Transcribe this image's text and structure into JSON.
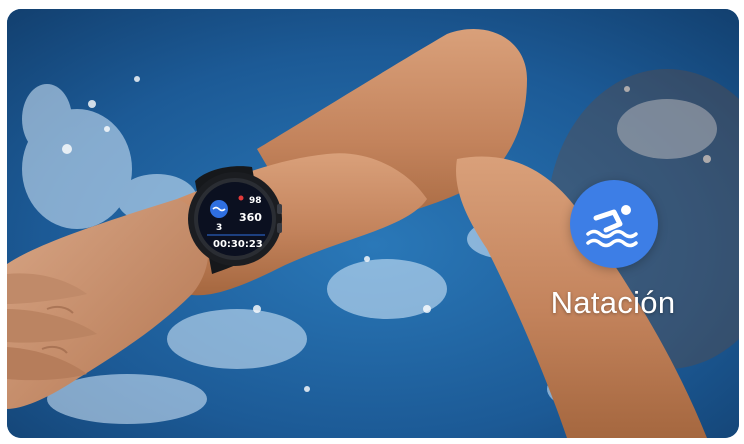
{
  "activity": {
    "label": "Natación",
    "icon": "swimming-icon",
    "badge_color": "#3d7ee6"
  },
  "watch_screen": {
    "heart_rate": "98",
    "distance": "360",
    "laps": "3",
    "duration": "00:30:23"
  },
  "colors": {
    "water": "#1f5d96",
    "skin": "#c98a63",
    "watch_body": "#1b1d21"
  }
}
